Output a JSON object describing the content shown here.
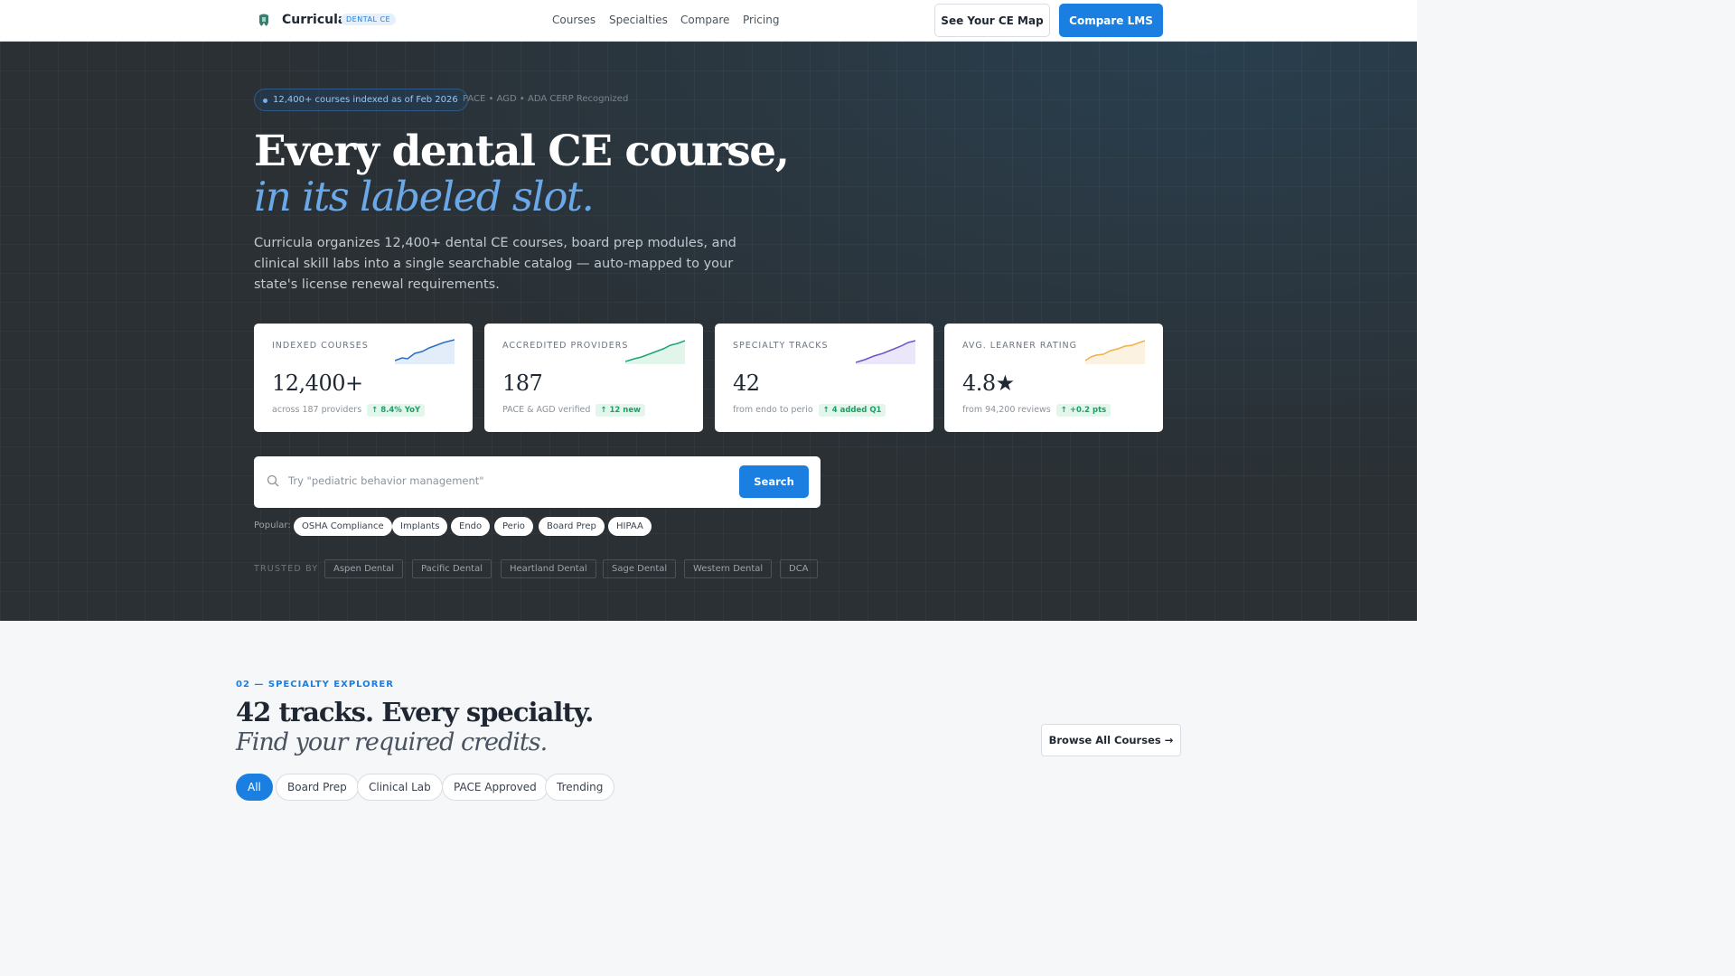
{
  "nav": {
    "brand": "Curricula",
    "brand_tag": "DENTAL CE",
    "links": [
      "Courses",
      "Specialties",
      "Compare",
      "Pricing"
    ],
    "cta_secondary": "See Your CE Map",
    "cta_primary": "Compare LMS"
  },
  "hero": {
    "pill": "12,400+ courses indexed as of Feb 2026",
    "accreditation": "PACE • AGD • ADA CERP Recognized",
    "title_line1": "Every dental CE course,",
    "title_line2": "in its labeled slot.",
    "lede": "Curricula organizes 12,400+ dental CE courses, board prep modules, and clinical skill labs into a single searchable catalog — auto-mapped to your state's license renewal requirements.",
    "stats": [
      {
        "label": "INDEXED COURSES",
        "value": "12,400+",
        "sub": "across 187 providers",
        "delta": "↑ 8.4% YoY",
        "spark_color": "#2a6fc4"
      },
      {
        "label": "ACCREDITED PROVIDERS",
        "value": "187",
        "sub": "PACE & AGD verified",
        "delta": "↑ 12 new",
        "spark_color": "#1aa575"
      },
      {
        "label": "SPECIALTY TRACKS",
        "value": "42",
        "sub": "from endo to perio",
        "delta": "↑ 4 added Q1",
        "spark_color": "#6d54c9"
      },
      {
        "label": "AVG. LEARNER RATING",
        "value": "4.8★",
        "sub": "from 94,200 reviews",
        "delta": "↑ +0.2 pts",
        "spark_color": "#f0b04a"
      }
    ],
    "search": {
      "placeholder": "Try \"pediatric behavior management\"",
      "button": "Search"
    },
    "popular_label": "Popular:",
    "popular": [
      "OSHA Compliance",
      "Implants",
      "Endo",
      "Perio",
      "Board Prep",
      "HIPAA"
    ],
    "trusted_label": "TRUSTED BY",
    "trusted": [
      "Aspen Dental",
      "Pacific Dental",
      "Heartland Dental",
      "Sage Dental",
      "Western Dental",
      "DCA"
    ]
  },
  "explorer": {
    "eyebrow": "02 — SPECIALTY EXPLORER",
    "title": "42 tracks. Every specialty.",
    "subtitle": "Find your required credits.",
    "browse": "Browse All Courses →",
    "filters": [
      "All",
      "Board Prep",
      "Clinical Lab",
      "PACE Approved",
      "Trending"
    ]
  },
  "colors": {
    "accent": "#1a7fe0",
    "hero_bg": "#2a3034",
    "accent_italic": "#6aa8e8"
  }
}
